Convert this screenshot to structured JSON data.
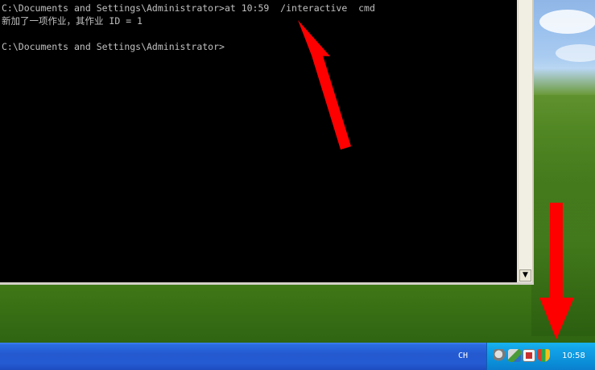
{
  "console": {
    "lines": [
      "C:\\Documents and Settings\\Administrator>at 10:59  /interactive  cmd",
      "新加了一项作业，其作业 ID = 1",
      "",
      "C:\\Documents and Settings\\Administrator>"
    ],
    "scroll_down_glyph": "▼"
  },
  "annotations": {
    "arrow_color": "#ff0000"
  },
  "taskbar": {
    "language_indicator": "CH",
    "tray_icons": [
      "network-icon",
      "satellite-icon",
      "update-icon",
      "security-shield-icon"
    ],
    "clock": "10:58"
  },
  "colors": {
    "console_bg": "#000000",
    "console_text": "#c0c0c0",
    "taskbar_blue": "#245ad2",
    "tray_blue": "#0f9ae2"
  }
}
